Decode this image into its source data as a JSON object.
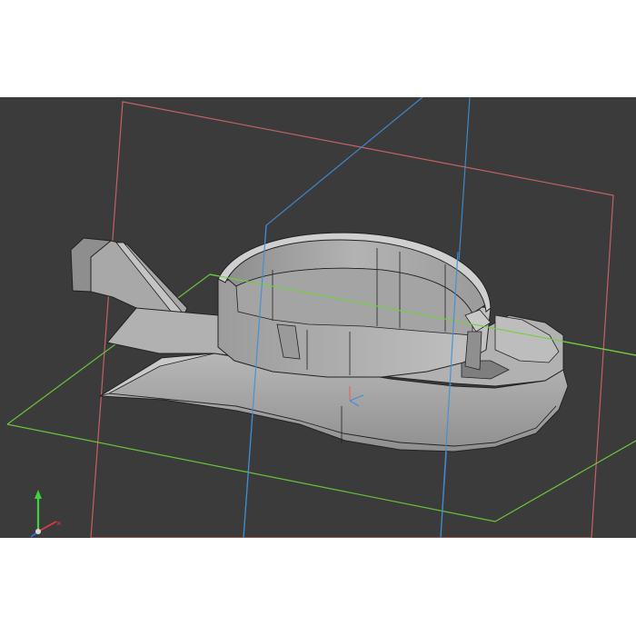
{
  "viewport": {
    "background": "#3b3b3b",
    "view": "perspective"
  },
  "model": {
    "part_type": "ring clip mount",
    "shading_color": "#a9a9a9",
    "edge_color": "#222222"
  },
  "planes": {
    "xy_plane_color": "#6fd13a",
    "xz_plane_color": "#d96a6a",
    "yz_plane_color": "#3f8fd6"
  },
  "axis_triad": {
    "x_icon": "x-axis-arrow",
    "y_icon": "y-axis-arrow",
    "z_icon": "z-axis-arrow",
    "x_color": "#e23b3b",
    "y_color": "#3fd13f",
    "z_color": "#3b6fe2"
  }
}
